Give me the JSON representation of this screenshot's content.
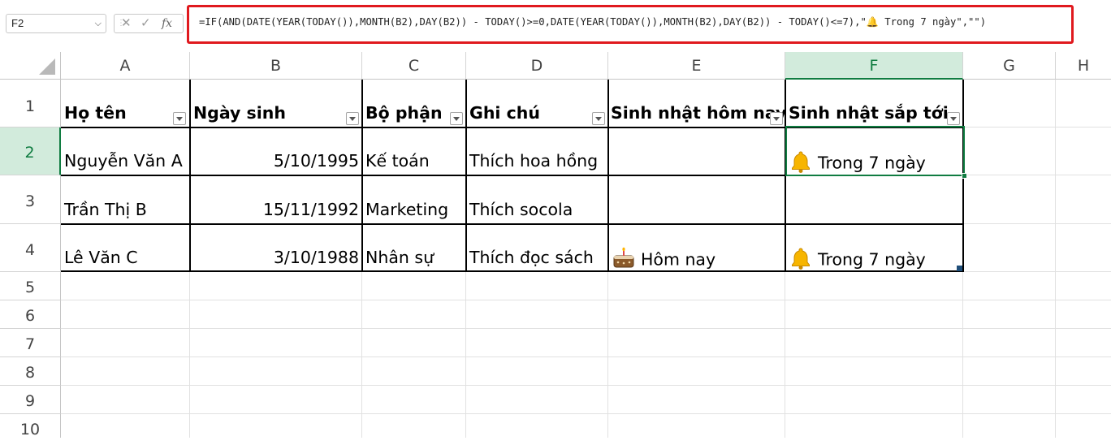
{
  "name_box": "F2",
  "formula_bar": {
    "cancel_icon": "close-icon",
    "enter_icon": "check-icon",
    "fx_label": "fx",
    "formula": "=IF(AND(DATE(YEAR(TODAY()),MONTH(B2),DAY(B2)) - TODAY()>=0,DATE(YEAR(TODAY()),MONTH(B2),DAY(B2)) - TODAY()<=7),\"🔔 Trong 7 ngày\",\"\")",
    "highlight_color": "#e0191e"
  },
  "columns": [
    "A",
    "B",
    "C",
    "D",
    "E",
    "F",
    "G",
    "H"
  ],
  "rows": [
    "1",
    "2",
    "3",
    "4",
    "5",
    "6",
    "7",
    "8",
    "9",
    "10"
  ],
  "selected_cell": {
    "column": "F",
    "row": "2",
    "color": "#107c41"
  },
  "table": {
    "headers": [
      "Họ tên",
      "Ngày sinh",
      "Bộ phận",
      "Ghi chú",
      "Sinh nhật hôm nay",
      "Sinh nhật sắp tới"
    ],
    "rows": [
      {
        "name": "Nguyễn Văn A",
        "birth": "5/10/1995",
        "dept": "Kế toán",
        "note": "Thích hoa hồng",
        "today": "",
        "upcoming": "Trong 7 ngày"
      },
      {
        "name": "Trần Thị B",
        "birth": "15/11/1992",
        "dept": "Marketing",
        "note": "Thích socola",
        "today": "",
        "upcoming": ""
      },
      {
        "name": "Lê Văn C",
        "birth": "3/10/1988",
        "dept": "Nhân sự",
        "note": "Thích đọc sách",
        "today": "Hôm nay",
        "upcoming": "Trong 7 ngày"
      }
    ]
  },
  "icons": {
    "upcoming": "bell-icon",
    "today": "birthday-cake-icon"
  }
}
